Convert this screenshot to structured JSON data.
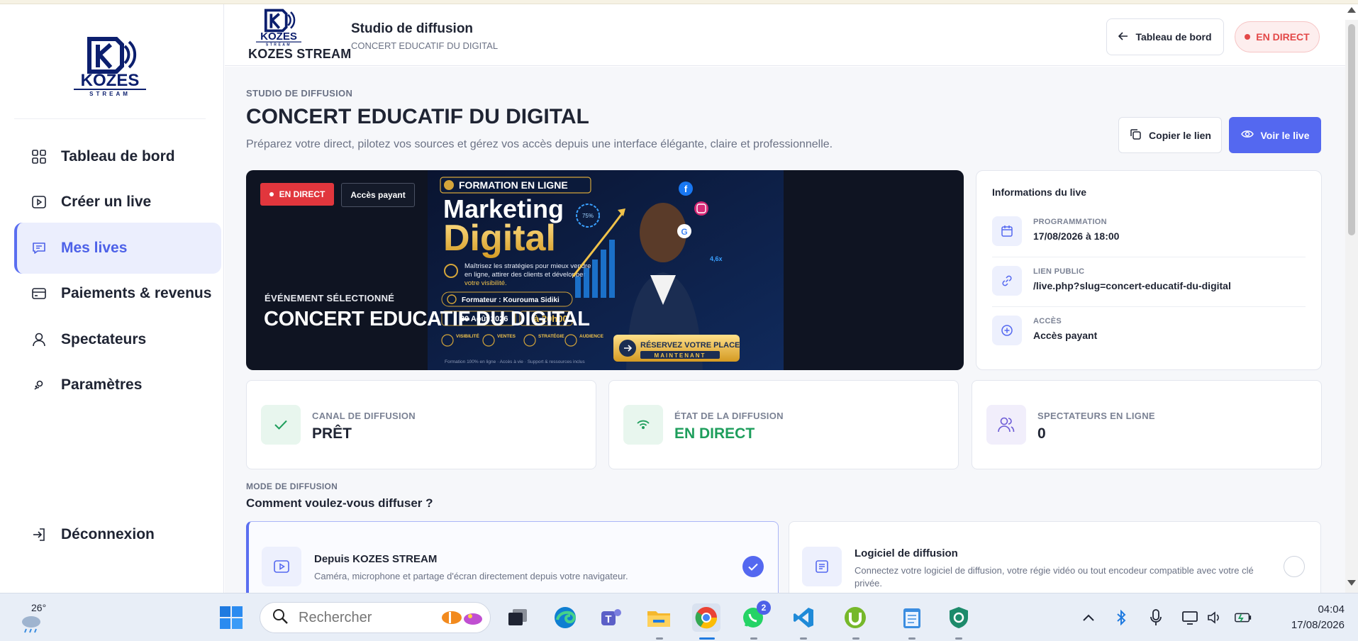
{
  "brand": {
    "name": "KOZES STREAM",
    "logo_text": "KOZES",
    "logo_sub": "STREAM"
  },
  "sidebar": {
    "items": [
      {
        "label": "Tableau de bord",
        "icon": "grid-icon"
      },
      {
        "label": "Créer un live",
        "icon": "play-square-icon"
      },
      {
        "label": "Mes lives",
        "icon": "chat-square-icon",
        "active": true
      },
      {
        "label": "Paiements & revenus",
        "icon": "card-icon"
      },
      {
        "label": "Spectateurs",
        "icon": "user-icon"
      },
      {
        "label": "Paramètres",
        "icon": "settings-icon"
      }
    ],
    "logout": "Déconnexion"
  },
  "header": {
    "title": "Studio de diffusion",
    "subtitle": "CONCERT EDUCATIF DU DIGITAL",
    "back_label": "Tableau de bord",
    "live_label": "EN DIRECT"
  },
  "page": {
    "kicker": "STUDIO DE DIFFUSION",
    "title": "CONCERT EDUCATIF DU DIGITAL",
    "description": "Préparez votre direct, pilotez vos sources et gérez vos accès depuis une interface élégante, claire et professionnelle.",
    "copy_label": "Copier le lien",
    "view_label": "Voir le live"
  },
  "hero": {
    "badge_live": "EN DIRECT",
    "badge_access": "Accès payant",
    "kicker": "ÉVÉNEMENT SÉLECTIONNÉ",
    "title": "CONCERT EDUCATIF DU DIGITAL",
    "poster": {
      "tag": "FORMATION EN LIGNE",
      "line1": "Marketing",
      "line2": "Digital",
      "desc1": "Maîtrisez les stratégies pour mieux vendre",
      "desc2": "en ligne, attirer des clients et développer",
      "desc3": "votre visibilité.",
      "trainer": "Formateur : Kourouma Sidiki",
      "date": "30 Août 2026",
      "time": "à 20h00",
      "cta1": "RÉSERVEZ VOTRE PLACE",
      "cta2": "MAINTENANT",
      "footer": "Formation 100% en ligne · Accès à vie · Support & ressources inclus",
      "pct": "75%",
      "growth": "4,6x",
      "feature1": "VISIBILITÉ",
      "feature2": "VENTES",
      "feature3": "STRATÉGIE",
      "feature4": "AUDIENCE"
    }
  },
  "info": {
    "title": "Informations du live",
    "rows": [
      {
        "key": "PROGRAMMATION",
        "value": "17/08/2026 à 18:00",
        "icon": "calendar-icon"
      },
      {
        "key": "LIEN PUBLIC",
        "value": "/live.php?slug=concert-educatif-du-digital",
        "icon": "link-icon"
      },
      {
        "key": "ACCÈS",
        "value": "Accès payant",
        "icon": "plus-circle-icon"
      }
    ]
  },
  "stats": [
    {
      "key": "CANAL DE DIFFUSION",
      "value": "PRÊT",
      "icon": "check-icon",
      "color": "#1f2433"
    },
    {
      "key": "ÉTAT DE LA DIFFUSION",
      "value": "EN DIRECT",
      "icon": "broadcast-icon",
      "color": "#1e9e5c"
    },
    {
      "key": "SPECTATEURS EN LIGNE",
      "value": "0",
      "icon": "users-icon",
      "color": "#1f2433"
    }
  ],
  "mode": {
    "kicker": "MODE DE DIFFUSION",
    "title": "Comment voulez-vous diffuser ?",
    "options": [
      {
        "title": "Depuis KOZES STREAM",
        "desc": "Caméra, microphone et partage d'écran directement depuis votre navigateur.",
        "selected": true
      },
      {
        "title": "Logiciel de diffusion",
        "desc": "Connectez votre logiciel de diffusion, votre régie vidéo ou tout encodeur compatible avec votre clé privée.",
        "selected": false
      }
    ]
  },
  "taskbar": {
    "temperature": "26°",
    "search_placeholder": "Rechercher",
    "time": "04:04",
    "date": "17/08/2026",
    "whatsapp_badge": "2"
  },
  "colors": {
    "accent": "#5468f0",
    "live": "#e1363d",
    "success": "#1e9e5c"
  }
}
